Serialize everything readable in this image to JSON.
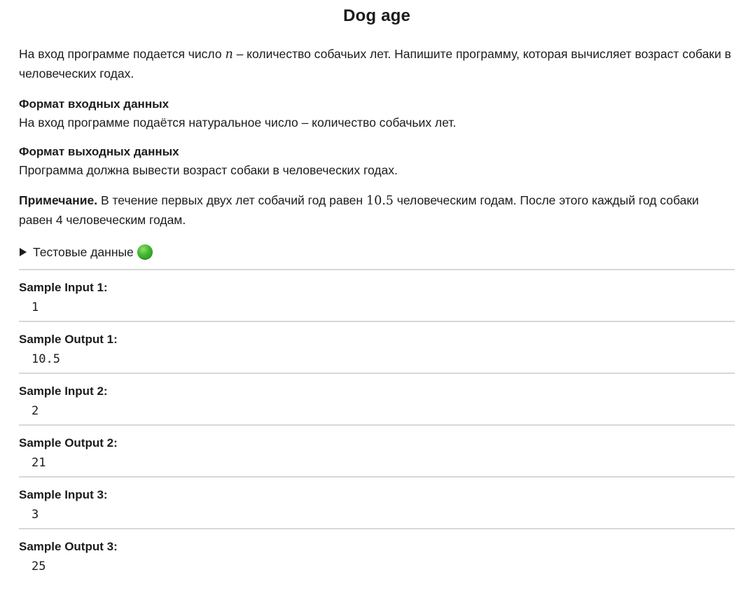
{
  "title": "Dog age",
  "intro": {
    "before": "На вход программе подается число ",
    "var": "n",
    "after": " – количество собачьих лет. Напишите программу, которая вычисляет возраст собаки в человеческих годах."
  },
  "input_format": {
    "heading": "Формат входных данных",
    "text": "На вход программе подаётся натуральное число – количество собачьих лет."
  },
  "output_format": {
    "heading": "Формат выходных данных",
    "text": "Программа должна вывести возраст собаки в человеческих годах."
  },
  "note": {
    "label": "Примечание.",
    "before": " В течение первых двух лет собачий год равен ",
    "value": "10.5",
    "after": " человеческим годам. После этого каждый год собаки равен 4 человеческим годам."
  },
  "tests": {
    "label": "Тестовые данные",
    "status_color": "#3fb52d"
  },
  "samples": [
    {
      "label": "Sample Input 1:",
      "value": "1"
    },
    {
      "label": "Sample Output 1:",
      "value": "10.5"
    },
    {
      "label": "Sample Input 2:",
      "value": "2"
    },
    {
      "label": "Sample Output 2:",
      "value": "21"
    },
    {
      "label": "Sample Input 3:",
      "value": "3"
    },
    {
      "label": "Sample Output 3:",
      "value": "25"
    }
  ]
}
